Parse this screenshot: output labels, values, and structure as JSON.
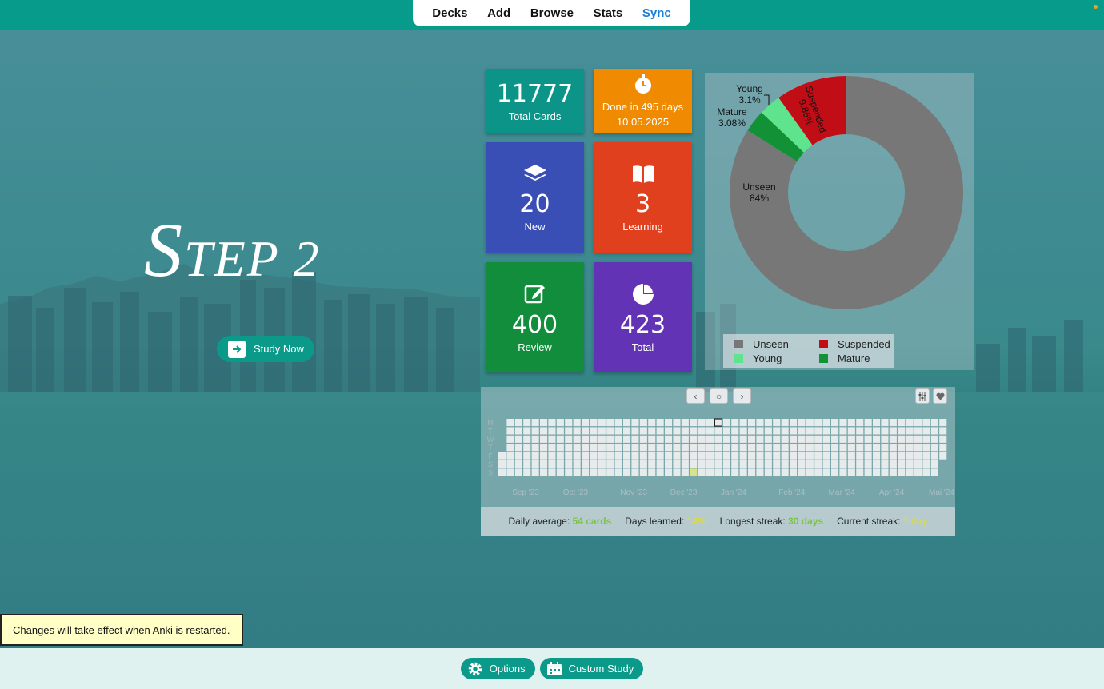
{
  "nav": {
    "items": [
      "Decks",
      "Add",
      "Browse",
      "Stats",
      "Sync"
    ]
  },
  "hero": {
    "title_big": "S",
    "title_rest": "TEP 2",
    "study_label": "Study Now"
  },
  "tiles": {
    "total_cards": {
      "value": "11777",
      "label": "Total Cards",
      "color": "#0b9487"
    },
    "done_in": {
      "line1": "Done in 495 days",
      "line2": "10.05.2025",
      "color": "#f08a00"
    },
    "new": {
      "value": "20",
      "label": "New",
      "color": "#3a4fb6"
    },
    "learning": {
      "value": "3",
      "label": "Learning",
      "color": "#e0401e"
    },
    "review": {
      "value": "400",
      "label": "Review",
      "color": "#128d3c"
    },
    "total": {
      "value": "423",
      "label": "Total",
      "color": "#6233b4"
    }
  },
  "chart_data": {
    "type": "pie",
    "style": "donut",
    "slices": [
      {
        "label": "Unseen",
        "value": 84,
        "display": "84%",
        "color": "#777777"
      },
      {
        "label": "Mature",
        "value": 3.08,
        "display": "3.08%",
        "color": "#129136"
      },
      {
        "label": "Young",
        "value": 3.1,
        "display": "3.1%",
        "color": "#5fe38c"
      },
      {
        "label": "Suspended",
        "value": 9.86,
        "display": "9.86%",
        "color": "#c00d16"
      }
    ],
    "legend": [
      {
        "label": "Unseen",
        "color": "#777777"
      },
      {
        "label": "Suspended",
        "color": "#c00d16"
      },
      {
        "label": "Young",
        "color": "#5fe38c"
      },
      {
        "label": "Mature",
        "color": "#129136"
      }
    ],
    "legend_position": "bottom"
  },
  "heatmap": {
    "weekday_labels": [
      "M",
      "T",
      "W",
      "T",
      "F",
      "S",
      "S"
    ],
    "month_labels": [
      "Sep '23",
      "Oct '23",
      "Nov '23",
      "Dec '23",
      "Jan '24",
      "Feb '24",
      "Mar '24",
      "Apr '24",
      "Mai '24"
    ],
    "buttons": {
      "prev": "‹",
      "today": "○",
      "next": "›"
    },
    "stats": {
      "daily_average_label": "Daily average:",
      "daily_average_value": "54 cards",
      "days_learned_label": "Days learned:",
      "days_learned_value": "14%",
      "longest_streak_label": "Longest streak:",
      "longest_streak_value": "30 days",
      "current_streak_label": "Current streak:",
      "current_streak_value": "1 day"
    }
  },
  "toast": {
    "text": "Changes will take effect when Anki is restarted."
  },
  "bottom": {
    "options_label": "Options",
    "custom_study_label": "Custom Study"
  }
}
